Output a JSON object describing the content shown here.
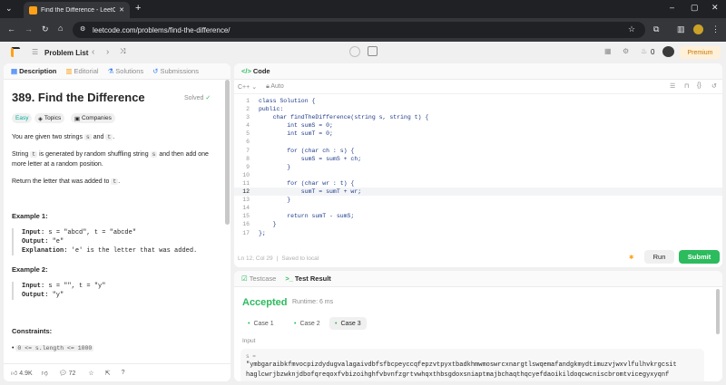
{
  "browser": {
    "tab_title": "Find the Difference - LeetCode",
    "new_tab": "+",
    "url": "leetcode.com/problems/find-the-difference/",
    "window_controls": [
      "–",
      "▢",
      "✕"
    ]
  },
  "nav": {
    "problem_list": "Problem List",
    "coins": "0",
    "premium": "Premium"
  },
  "left_panel": {
    "tabs": [
      "Description",
      "Editorial",
      "Solutions",
      "Submissions"
    ],
    "title": "389. Find the Difference",
    "status": "Solved",
    "chips": [
      "Easy",
      "Topics",
      "Companies"
    ],
    "desc": {
      "p1_a": "You are given two strings ",
      "p1_s": "s",
      "p1_b": " and ",
      "p1_t": "t",
      "p1_c": ".",
      "p2_a": "String ",
      "p2_t": "t",
      "p2_b": " is generated by random shuffling string ",
      "p2_s": "s",
      "p2_c": " and then add one more letter at a random position.",
      "p3_a": "Return the letter that was added to ",
      "p3_t": "t",
      "p3_c": "."
    },
    "examples": [
      {
        "heading": "Example 1:",
        "input_label": "Input:",
        "input": " s = \"abcd\", t = \"abcde\"",
        "output_label": "Output:",
        "output": " \"e\"",
        "explanation_label": "Explanation:",
        "explanation": " 'e' is the letter that was added."
      },
      {
        "heading": "Example 2:",
        "input_label": "Input:",
        "input": " s = \"\", t = \"y\"",
        "output_label": "Output:",
        "output": " \"y\""
      }
    ],
    "constraints_heading": "Constraints:",
    "constraint_1": "0 <= s.length <= 1000",
    "footer": {
      "likes": "4.9K",
      "comments": "72"
    }
  },
  "editor": {
    "header": "Code",
    "language": "C++",
    "mode": "Auto",
    "lines": [
      "class Solution {",
      "public:",
      "    char findTheDifference(string s, string t) {",
      "        int sumS = 0;",
      "        int sumT = 0;",
      "",
      "        for (char ch : s) {",
      "            sumS = sumS + ch;",
      "        }",
      "",
      "        for (char wr : t) {",
      "            sumT = sumT + wr;",
      "        }",
      "",
      "        return sumT - sumS;",
      "    }",
      "};"
    ],
    "line_numbers": [
      "1",
      "2",
      "3",
      "4",
      "5",
      "6",
      "7",
      "8",
      "9",
      "10",
      "11",
      "12",
      "13",
      "14",
      "15",
      "16",
      "17"
    ],
    "status": "Ln 12, Col 29",
    "saved": "Saved to local",
    "run_label": "Run",
    "submit_label": "Submit"
  },
  "result": {
    "tabs": [
      "Testcase",
      "Test Result"
    ],
    "verdict": "Accepted",
    "runtime": "Runtime: 6 ms",
    "cases": [
      "Case 1",
      "Case 2",
      "Case 3"
    ],
    "input_label": "Input",
    "var_label": "s =",
    "value_line1": "\"ymbgaraibkfmvocpizdydugvalagaivdbfsfbcpeyccqfepzvtpyxtbadkhmwmoswrcxnargtlswqemafandgkmydtimuzvjwxvlfulhvkrgcsit",
    "value_line2": "haglcwrjbzwknjdbofqreqoxfvbizoihghfvbvnfzgrtvwhqxthbsgdoxsniaptmajbchaqthqcyefdaoikildoqcwcniscbromtvicegyxyqnf"
  },
  "colors": {
    "accent_green": "#2cbb5d",
    "easy": "#00af9b",
    "brand_orange": "#ffa116"
  }
}
